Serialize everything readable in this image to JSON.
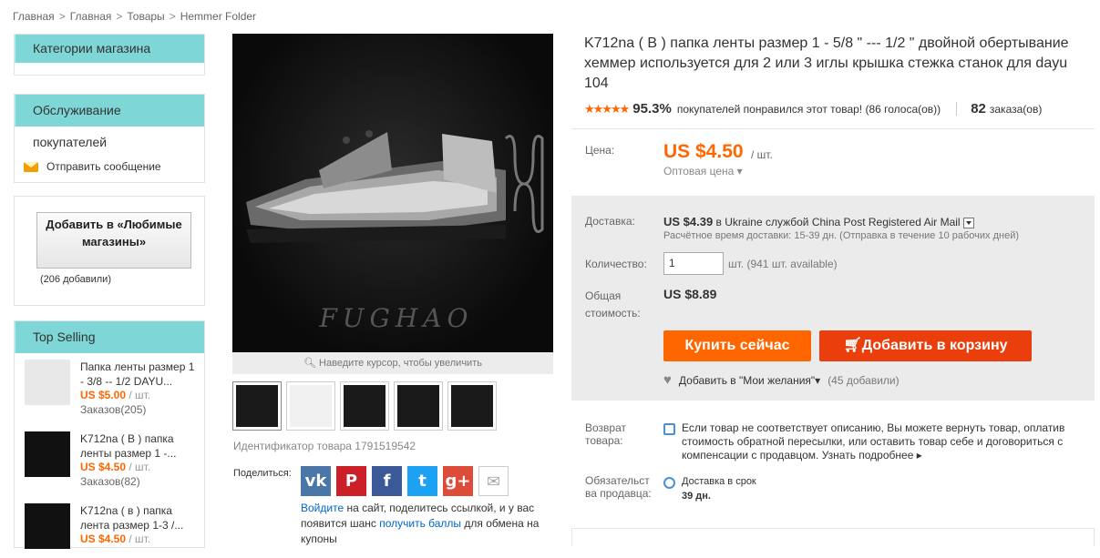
{
  "breadcrumb": [
    "Главная",
    "Главная",
    "Товары",
    "Hemmer Folder"
  ],
  "sidebar": {
    "categories_title": "Категории магазина",
    "service_title": "Обслуживание покупателей",
    "send_message": "Отправить сообщение",
    "fav_button": "Добавить в «Любимые магазины»",
    "fav_count": "(206 добавили)",
    "top_selling_title": "Top Selling",
    "top_selling": [
      {
        "title": "Папка ленты размер 1 - 3/8 -- 1/2 DAYU...",
        "price": "US $5.00",
        "unit": " / шт.",
        "orders": "Заказов(205)"
      },
      {
        "title": "K712na ( B ) папка ленты размер 1 -...",
        "price": "US $4.50",
        "unit": " / шт.",
        "orders": "Заказов(82)"
      },
      {
        "title": "K712na ( в ) папка лента размер 1-3 /...",
        "price": "US $4.50",
        "unit": " / шт.",
        "orders": ""
      }
    ]
  },
  "gallery": {
    "watermark": "FUGHAO",
    "zoom_hint": "Наведите курсор, чтобы увеличить",
    "item_id": "Идентификатор товара 1791519542"
  },
  "share": {
    "label": "Поделиться:",
    "icons": [
      "vk",
      "P",
      "f",
      "t",
      "g+",
      "email"
    ],
    "text_login": "Войдите",
    "text_mid": " на сайт, поделитесь ссылкой, и у вас появится шанс ",
    "text_points": "получить баллы",
    "text_end": " для обмена на купоны"
  },
  "product": {
    "title": "K712na ( B ) папка ленты размер 1 - 5/8 \" --- 1/2 \" двойной обертывание хеммер используется для 2 или 3 иглы крышка стежка станок для dayu 104",
    "rating_pct": "95.3%",
    "rating_text": "покупателей понравился этот товар! (86 голоса(ов))",
    "orders_count": "82",
    "orders_label": "заказа(ов)",
    "price_label": "Цена:",
    "price": "US $4.50",
    "price_unit": "/ шт.",
    "wholesale": "Оптовая цена",
    "shipping_label": "Доставка:",
    "shipping_price": "US $4.39",
    "shipping_to": "в",
    "shipping_country": "Ukraine службой China Post Registered Air Mail",
    "delivery_time": "Расчётное время доставки: 15-39 дн. (Отправка в течение 10 рабочих дней)",
    "qty_label": "Количество:",
    "qty_value": "1",
    "qty_unit": "шт. (941 шт. available)",
    "total_label_1": "Общая",
    "total_label_2": "стоимость:",
    "total": "US $8.89",
    "buy_now": "Купить сейчас",
    "add_to_cart": "Добавить в корзину",
    "wishlist": "Добавить в \"Мои желания\"",
    "wishlist_count": "(45 добавили)",
    "return_label_1": "Возврат",
    "return_label_2": "товара:",
    "return_text": "Если товар не соответствует описанию, Вы можете вернуть товар, оплатив стоимость обратной пересылки, или оставить товар себе и договориться с компенсации с продавцом.",
    "return_more": "Узнать подробнее",
    "seller_label_1": "Обязательст",
    "seller_label_2": "ва продавца:",
    "seller_title": "Доставка в срок",
    "seller_days": "39 дн."
  }
}
